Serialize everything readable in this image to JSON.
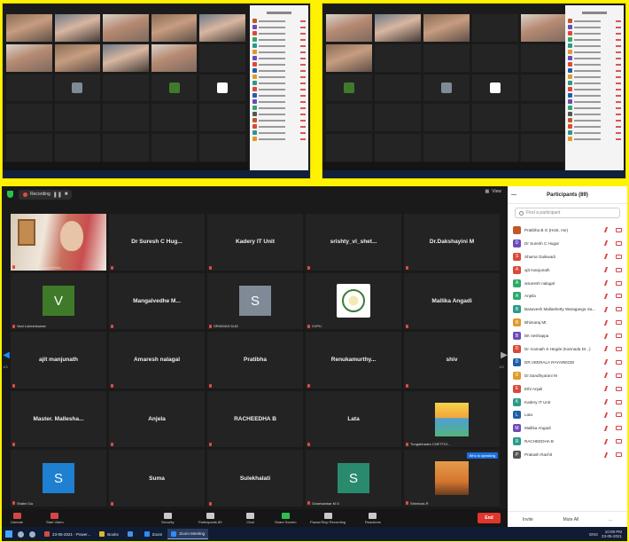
{
  "meeting": {
    "recording_label": "Recording",
    "view_label": "View",
    "panel_title": "Participants (89)",
    "search_placeholder": "Find a participant",
    "page_left": "1/3",
    "page_right": "1/3",
    "hover_tip": "Who is speaking"
  },
  "tiles": [
    {
      "kind": "video",
      "caption": "Dr. Devbhat Bhagwat (Host)"
    },
    {
      "kind": "name",
      "name": "Dr Suresh C Hug...",
      "caption": ""
    },
    {
      "kind": "name",
      "name": "Kadery IT Unit",
      "caption": ""
    },
    {
      "kind": "name",
      "name": "srishty_vl_shet...",
      "caption": ""
    },
    {
      "kind": "name",
      "name": "Dr.Dakshayini M",
      "caption": ""
    },
    {
      "kind": "avatar",
      "letter": "V",
      "color": "#3f7a2a",
      "caption": "Vani Lokeshkumar"
    },
    {
      "kind": "name",
      "name": "Mangalvedhe M...",
      "caption": ""
    },
    {
      "kind": "avatar",
      "letter": "S",
      "color": "#7f8a96",
      "caption": "SRINIVAS KUD"
    },
    {
      "kind": "logo",
      "caption": "VVPU"
    },
    {
      "kind": "name",
      "name": "Mallika Angadi",
      "caption": ""
    },
    {
      "kind": "name",
      "name": "ajit manjunath",
      "caption": ""
    },
    {
      "kind": "name",
      "name": "Amaresh nalagal",
      "caption": ""
    },
    {
      "kind": "name",
      "name": "Pratibha",
      "caption": ""
    },
    {
      "kind": "name",
      "name": "Renukamurthy...",
      "caption": ""
    },
    {
      "kind": "name",
      "name": "shiv",
      "caption": ""
    },
    {
      "kind": "name",
      "name": "Master. Mallesha...",
      "caption": ""
    },
    {
      "kind": "name",
      "name": "Anjela",
      "caption": ""
    },
    {
      "kind": "name",
      "name": "RACHEEDHA B",
      "caption": ""
    },
    {
      "kind": "name",
      "name": "Lata",
      "caption": ""
    },
    {
      "kind": "poster",
      "caption": "Tungabhadra CHETTIO..."
    },
    {
      "kind": "avatar",
      "letter": "S",
      "color": "#1f7fd1",
      "caption": "Shabri Ga"
    },
    {
      "kind": "name",
      "name": "Suma",
      "caption": ""
    },
    {
      "kind": "name",
      "name": "Sulekhalati",
      "caption": ""
    },
    {
      "kind": "avatar",
      "letter": "S",
      "color": "#2a8a6e",
      "caption": "Gowrisankar M G"
    },
    {
      "kind": "temple",
      "caption": "Shrinivas R"
    }
  ],
  "participants": [
    {
      "name": "Pratibha B G (Host, me)",
      "color": "#c0582c",
      "letter": "",
      "icon": "mic-video"
    },
    {
      "name": "Dr Suresh C Hugar",
      "color": "#6b4bb7",
      "letter": "D",
      "icon": "mic-video"
    },
    {
      "name": "Shama Gaikwadi",
      "color": "#d94a3a",
      "letter": "S",
      "icon": "mic-video"
    },
    {
      "name": "ajit manjunath",
      "color": "#d94a3a",
      "letter": "A",
      "icon": "mic-video"
    },
    {
      "name": "amaresh nalagal",
      "color": "#2fa86b",
      "letter": "A",
      "icon": "mic-video"
    },
    {
      "name": "Anjela",
      "color": "#2fa86b",
      "letter": "A",
      "icon": "mic-video"
    },
    {
      "name": "Basavesh Mallashetty Waraganga Sa...",
      "color": "#2a9a8a",
      "letter": "B",
      "icon": "mic-video"
    },
    {
      "name": "Bhimaraj Mt",
      "color": "#e09a2a",
      "letter": "B",
      "icon": "mic-video"
    },
    {
      "name": "BK seshappa",
      "color": "#6b4bb7",
      "letter": "B",
      "icon": "mic-video"
    },
    {
      "name": "Dr. Kamath S Hegde (Kannada Dr...)",
      "color": "#d94a3a",
      "letter": "D",
      "icon": "mic-video"
    },
    {
      "name": "DR.VEERALA RAYAREDDI",
      "color": "#1f5fa8",
      "letter": "D",
      "icon": "mic-video"
    },
    {
      "name": "Dr.Sandhyarani M",
      "color": "#e09a2a",
      "letter": "D",
      "icon": "mic-video"
    },
    {
      "name": "Ethi Anjali",
      "color": "#d94a3a",
      "letter": "E",
      "icon": "mic-video"
    },
    {
      "name": "Kadery IT Unit",
      "color": "#2a9a8a",
      "letter": "K",
      "icon": "mic-video"
    },
    {
      "name": "Lata",
      "color": "#1f5fa8",
      "letter": "L",
      "icon": "mic-video"
    },
    {
      "name": "Mallika Angadi",
      "color": "#6b4bb7",
      "letter": "M",
      "icon": "mic-video"
    },
    {
      "name": "RACHEEDHA B",
      "color": "#2a9a8a",
      "letter": "R",
      "icon": "mic-video"
    },
    {
      "name": "Prakash Rachit",
      "color": "#555555",
      "letter": "P",
      "icon": "mic-video"
    }
  ],
  "panel_footer": {
    "invite": "Invite",
    "mute_all": "Mute All",
    "more": "..."
  },
  "toolbar": {
    "unmute": "Unmute",
    "start_video": "Start Video",
    "security": "Security",
    "participants": "Participants",
    "participants_count": "89",
    "chat": "Chat",
    "share_screen": "Share Screen",
    "pause_recording": "Pause/Stop Recording",
    "reactions": "Reactions",
    "end": "End"
  },
  "taskbar": {
    "apps": [
      {
        "label": "23-05-2021 - Power...",
        "color": "#d94a3a",
        "active": false
      },
      {
        "label": "Books",
        "color": "#e0b52a",
        "active": false
      },
      {
        "label": "",
        "color": "#4a90e2",
        "active": false
      },
      {
        "label": "Zoom",
        "color": "#2d8cff",
        "active": false
      },
      {
        "label": "Zoom Meeting",
        "color": "#2d8cff",
        "active": true
      }
    ],
    "lang": "ENG",
    "time": "10:09 PM",
    "date": "23-05-2021"
  }
}
